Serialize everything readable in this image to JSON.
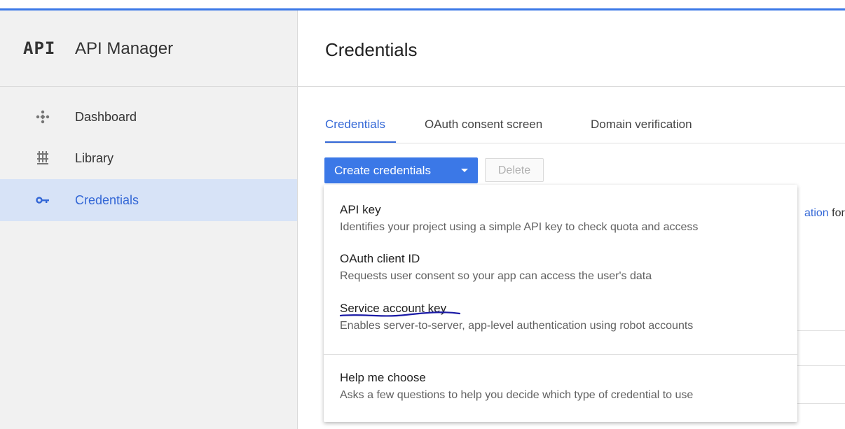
{
  "app": {
    "logo": "API",
    "name": "API Manager"
  },
  "sidebar": {
    "items": [
      {
        "label": "Dashboard",
        "icon": "dashboard-icon"
      },
      {
        "label": "Library",
        "icon": "library-icon"
      },
      {
        "label": "Credentials",
        "icon": "key-icon",
        "active": true
      }
    ]
  },
  "page": {
    "title": "Credentials",
    "tabs": [
      {
        "label": "Credentials",
        "active": true
      },
      {
        "label": "OAuth consent screen"
      },
      {
        "label": "Domain verification"
      }
    ],
    "create_button": "Create credentials",
    "delete_button": "Delete",
    "background_link_fragment": "ation",
    "background_text_fragment": " for"
  },
  "dropdown": {
    "items": [
      {
        "title": "API key",
        "description": "Identifies your project using a simple API key to check quota and access"
      },
      {
        "title": "OAuth client ID",
        "description": "Requests user consent so your app can access the user's data"
      },
      {
        "title": "Service account key",
        "description": "Enables server-to-server, app-level authentication using robot accounts"
      },
      {
        "title": "Help me choose",
        "description": "Asks a few questions to help you decide which type of credential to use"
      }
    ]
  },
  "colors": {
    "accent": "#3b78e7",
    "link": "#3367d6",
    "sidebar_active": "#d7e3f7",
    "annotation": "#1a1aa6"
  }
}
